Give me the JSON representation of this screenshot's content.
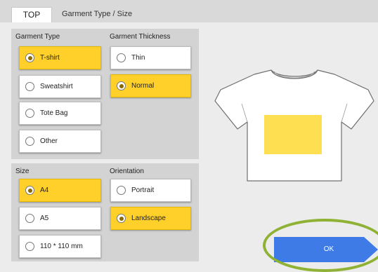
{
  "header": {
    "top_button": "TOP",
    "breadcrumb": "Garment Type / Size"
  },
  "garment_type": {
    "label": "Garment Type",
    "options": [
      {
        "label": "T-shirt",
        "selected": true
      },
      {
        "label": "Sweatshirt",
        "selected": false
      },
      {
        "label": "Tote Bag",
        "selected": false
      },
      {
        "label": "Other",
        "selected": false
      }
    ]
  },
  "garment_thickness": {
    "label": "Garment Thickness",
    "options": [
      {
        "label": "Thin",
        "selected": false
      },
      {
        "label": "Normal",
        "selected": true
      }
    ]
  },
  "size": {
    "label": "Size",
    "options": [
      {
        "label": "A4",
        "selected": true
      },
      {
        "label": "A5",
        "selected": false
      },
      {
        "label": "110 * 110 mm",
        "selected": false
      }
    ]
  },
  "orientation": {
    "label": "Orientation",
    "options": [
      {
        "label": "Portrait",
        "selected": false
      },
      {
        "label": "Landscape",
        "selected": true
      }
    ]
  },
  "preview": {
    "garment_icon": "tshirt-icon",
    "print_area_color": "#ffdf52"
  },
  "actions": {
    "ok_label": "OK"
  },
  "colors": {
    "selected": "#ffd02a",
    "ok_button": "#3e7be6",
    "highlight_ring": "#8fb234"
  }
}
